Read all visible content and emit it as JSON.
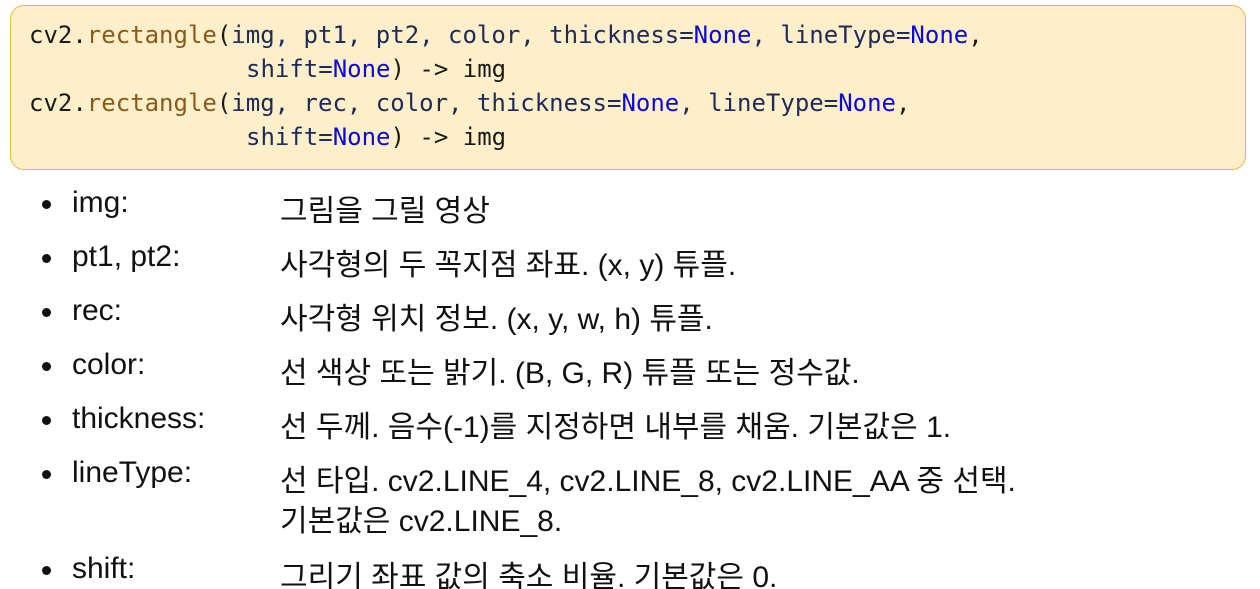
{
  "code": {
    "lines": [
      {
        "module": "cv2.",
        "func": "rectangle",
        "open": "(",
        "args1": "img, pt1, pt2, color, thickness=",
        "none1": "None",
        "args2": ", lineType=",
        "none2": "None",
        "tail": ","
      },
      {
        "args1": "shift=",
        "none1": "None",
        "tail": ") -> img"
      },
      {
        "module": "cv2.",
        "func": "rectangle",
        "open": "(",
        "args1": "img, rec, color, thickness=",
        "none1": "None",
        "args2": ", lineType=",
        "none2": "None",
        "tail": ","
      },
      {
        "args1": "shift=",
        "none1": "None",
        "tail": ") -> img"
      }
    ]
  },
  "params": [
    {
      "name": "img:",
      "desc": "그림을 그릴 영상"
    },
    {
      "name": "pt1, pt2:",
      "desc": "사각형의 두 꼭지점 좌표. (x, y) 튜플."
    },
    {
      "name": "rec:",
      "desc": "사각형 위치 정보. (x, y, w, h) 튜플."
    },
    {
      "name": "color:",
      "desc": "선 색상 또는 밝기. (B, G, R) 튜플 또는 정수값."
    },
    {
      "name": "thickness:",
      "desc": "선 두께. 음수(-1)를 지정하면 내부를 채움. 기본값은 1."
    },
    {
      "name": "lineType:",
      "desc": "선 타입. cv2.LINE_4, cv2.LINE_8, cv2.LINE_AA 중 선택.",
      "desc2": "기본값은 cv2.LINE_8."
    },
    {
      "name": "shift:",
      "desc": "그리기 좌표 값의 축소 비율. 기본값은 0."
    }
  ],
  "colors": {
    "box_bg": "#fdefc9",
    "box_border": "#e8b84a",
    "keyword": "#0a0ad8",
    "function": "#8a5a1a"
  }
}
